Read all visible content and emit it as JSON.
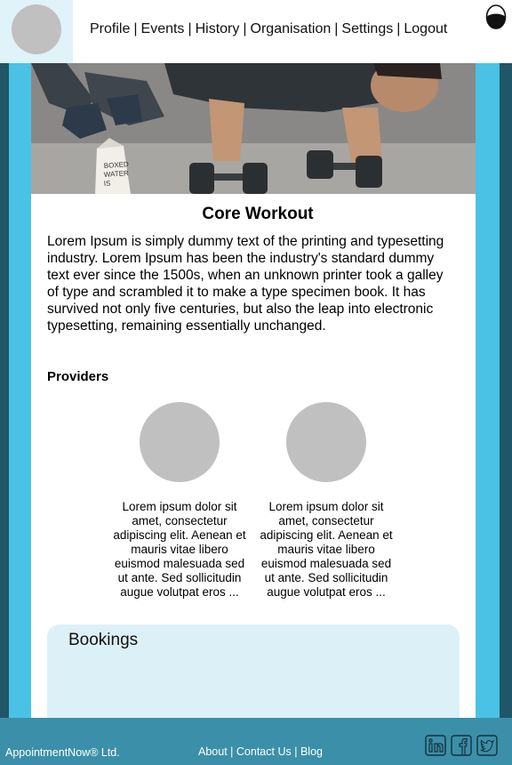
{
  "nav": {
    "items": [
      "Profile",
      "Events",
      "History",
      "Organisation",
      "Settings",
      "Logout"
    ],
    "separator": "|"
  },
  "event": {
    "title": "Core Workout",
    "description": "Lorem Ipsum is simply dummy text of the printing and typesetting industry. Lorem Ipsum has been the industry's standard dummy text ever since the 1500s, when an unknown printer took a galley of type and scrambled it to make a type specimen book. It has survived not only five centuries, but also the leap into electronic typesetting, remaining essentially unchanged.",
    "hero_carton_text": "BOXED WATER IS BETTER"
  },
  "providers": {
    "heading": "Providers",
    "items": [
      {
        "text": "Lorem ipsum dolor sit amet, consectetur adipiscing elit. Aenean et mauris vitae libero euismod malesuada sed ut ante. Sed sollicitudin augue volutpat eros ..."
      },
      {
        "text": "Lorem ipsum dolor sit amet, consectetur adipiscing elit. Aenean et mauris vitae libero euismod malesuada sed ut ante. Sed sollicitudin augue volutpat eros ..."
      }
    ]
  },
  "bookings": {
    "title": "Bookings"
  },
  "footer": {
    "company": "AppointmentNow® Ltd.",
    "links": [
      "About",
      "Contact Us",
      "Blog"
    ],
    "separator": "|",
    "social_icons": [
      "linkedin-icon",
      "facebook-icon",
      "twitter-icon"
    ]
  },
  "colors": {
    "band": "#4ac2e6",
    "outer": "#1f5766",
    "footer": "#3b8fa8",
    "bookings_bg": "#dcf1f7",
    "avatar_bg": "#dff3f8",
    "placeholder": "#c0c0c0"
  }
}
